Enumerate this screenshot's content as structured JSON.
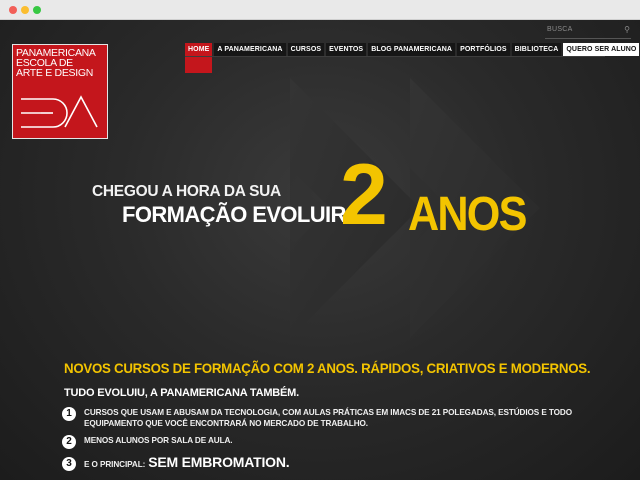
{
  "browser": {
    "buttons": [
      "close",
      "minimize",
      "maximize"
    ]
  },
  "search": {
    "label": "BUSCA",
    "icon": "search-icon"
  },
  "logo": {
    "lines": [
      "PANAMERICANA",
      "ESCOLA DE",
      "ARTE E DESIGN"
    ],
    "mark_text": "EPA",
    "background": "#c4161c"
  },
  "nav": {
    "items": [
      {
        "label": "HOME"
      },
      {
        "label": "A PANAMERICANA"
      },
      {
        "label": "CURSOS"
      },
      {
        "label": "EVENTOS"
      },
      {
        "label": "BLOG PANAMERICANA"
      },
      {
        "label": "PORTFÓLIOS"
      },
      {
        "label": "BIBLIOTECA"
      },
      {
        "label": "QUERO SER ALUNO"
      }
    ],
    "active": "HOME",
    "active_color": "#c4161c"
  },
  "hero": {
    "line1": "CHEGOU A HORA DA SUA",
    "line2": "FORMAÇÃO EVOLUIR:",
    "big_number": "2",
    "big_word": "ANOS",
    "accent_color": "#f3c400"
  },
  "content": {
    "headline": "NOVOS CURSOS DE FORMAÇÃO COM 2 ANOS. RÁPIDOS, CRIATIVOS E MODERNOS.",
    "intro": "TUDO EVOLUIU, A PANAMERICANA TAMBÉM.",
    "items": [
      {
        "number": "1",
        "text": "CURSOS QUE USAM E ABUSAM DA TECNOLOGIA,  COM AULAS PRÁTICAS EM IMACS DE 21 POLEGADAS,  ESTÚDIOS E TODO EQUIPAMENTO QUE VOCÊ ENCONTRARÁ NO MERCADO DE TRABALHO."
      },
      {
        "number": "2",
        "text": "MENOS ALUNOS POR SALA DE AULA."
      },
      {
        "number": "3",
        "prefix": "E O PRINCIPAL:",
        "strong": "SEM EMBROMATION."
      }
    ]
  }
}
